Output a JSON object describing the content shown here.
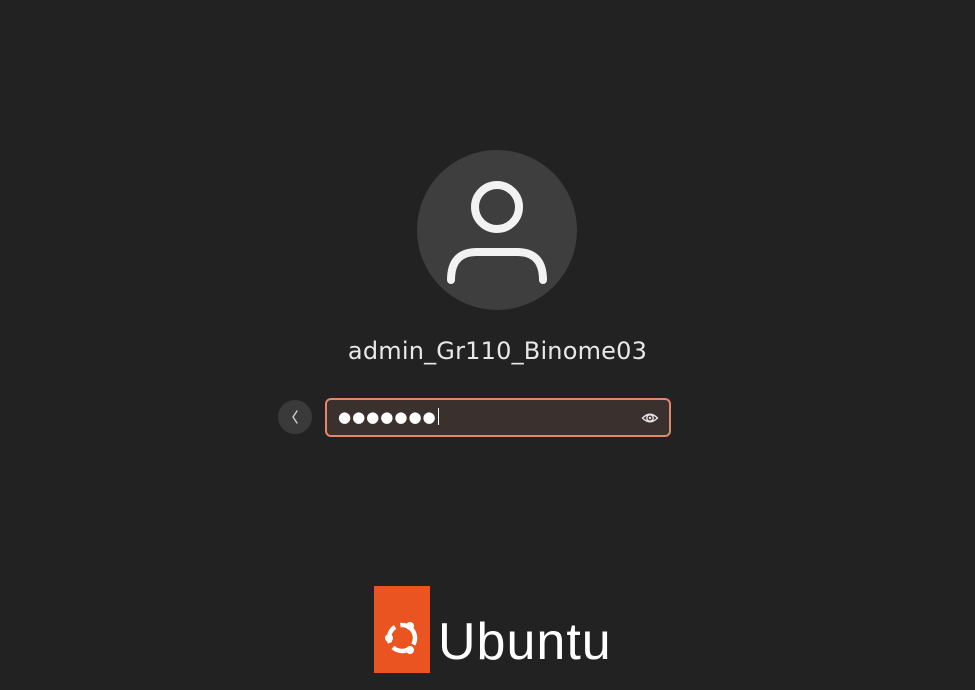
{
  "login": {
    "username": "admin_Gr110_Binome03",
    "password_masked": "●●●●●●●"
  },
  "branding": {
    "logo_text": "Ubuntu",
    "accent_color": "#e95420"
  },
  "icons": {
    "avatar": "user-icon",
    "back": "chevron-left-icon",
    "reveal": "eye-icon",
    "logo": "ubuntu-circle-of-friends-icon"
  },
  "colors": {
    "background": "#222222",
    "focus_border": "#e2876a"
  }
}
